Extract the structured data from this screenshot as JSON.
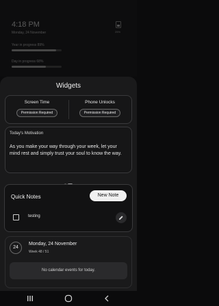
{
  "background": {
    "time": "4:18 PM",
    "date": "Monday, 24 November",
    "battery_pct": "25%",
    "year_progress": {
      "label": "Year in progress 89%",
      "value": 0.89
    },
    "day_progress": {
      "label": "Day in progress 68%",
      "value": 0.68
    }
  },
  "sheet": {
    "title": "Widgets",
    "screen_time": {
      "title": "Screen Time",
      "button": "Permission Required"
    },
    "phone_unlocks": {
      "title": "Phone Unlocks",
      "button": "Permission Required"
    },
    "motivation": {
      "title": "Today's Motivation",
      "text": "As you make your way through your week, let your mind rest and simply trust your soul to know the way."
    },
    "pager": {
      "count": 2,
      "active": 1
    },
    "notes": {
      "title": "Quick Notes",
      "new_button": "New Note",
      "items": [
        {
          "text": "testing",
          "checked": false
        }
      ]
    },
    "calendar": {
      "day_number": "24",
      "date": "Monday, 24 November",
      "week": "Week 48 / 51",
      "empty_message": "No calendar events for today."
    }
  },
  "colors": {
    "sheet": "#1a1a1b",
    "accent": "#f0f0f0",
    "border": "#3a3a3c"
  },
  "icons": {
    "edit": "pencil-icon",
    "recents": "recents-icon",
    "home": "home-icon",
    "back": "back-icon"
  }
}
